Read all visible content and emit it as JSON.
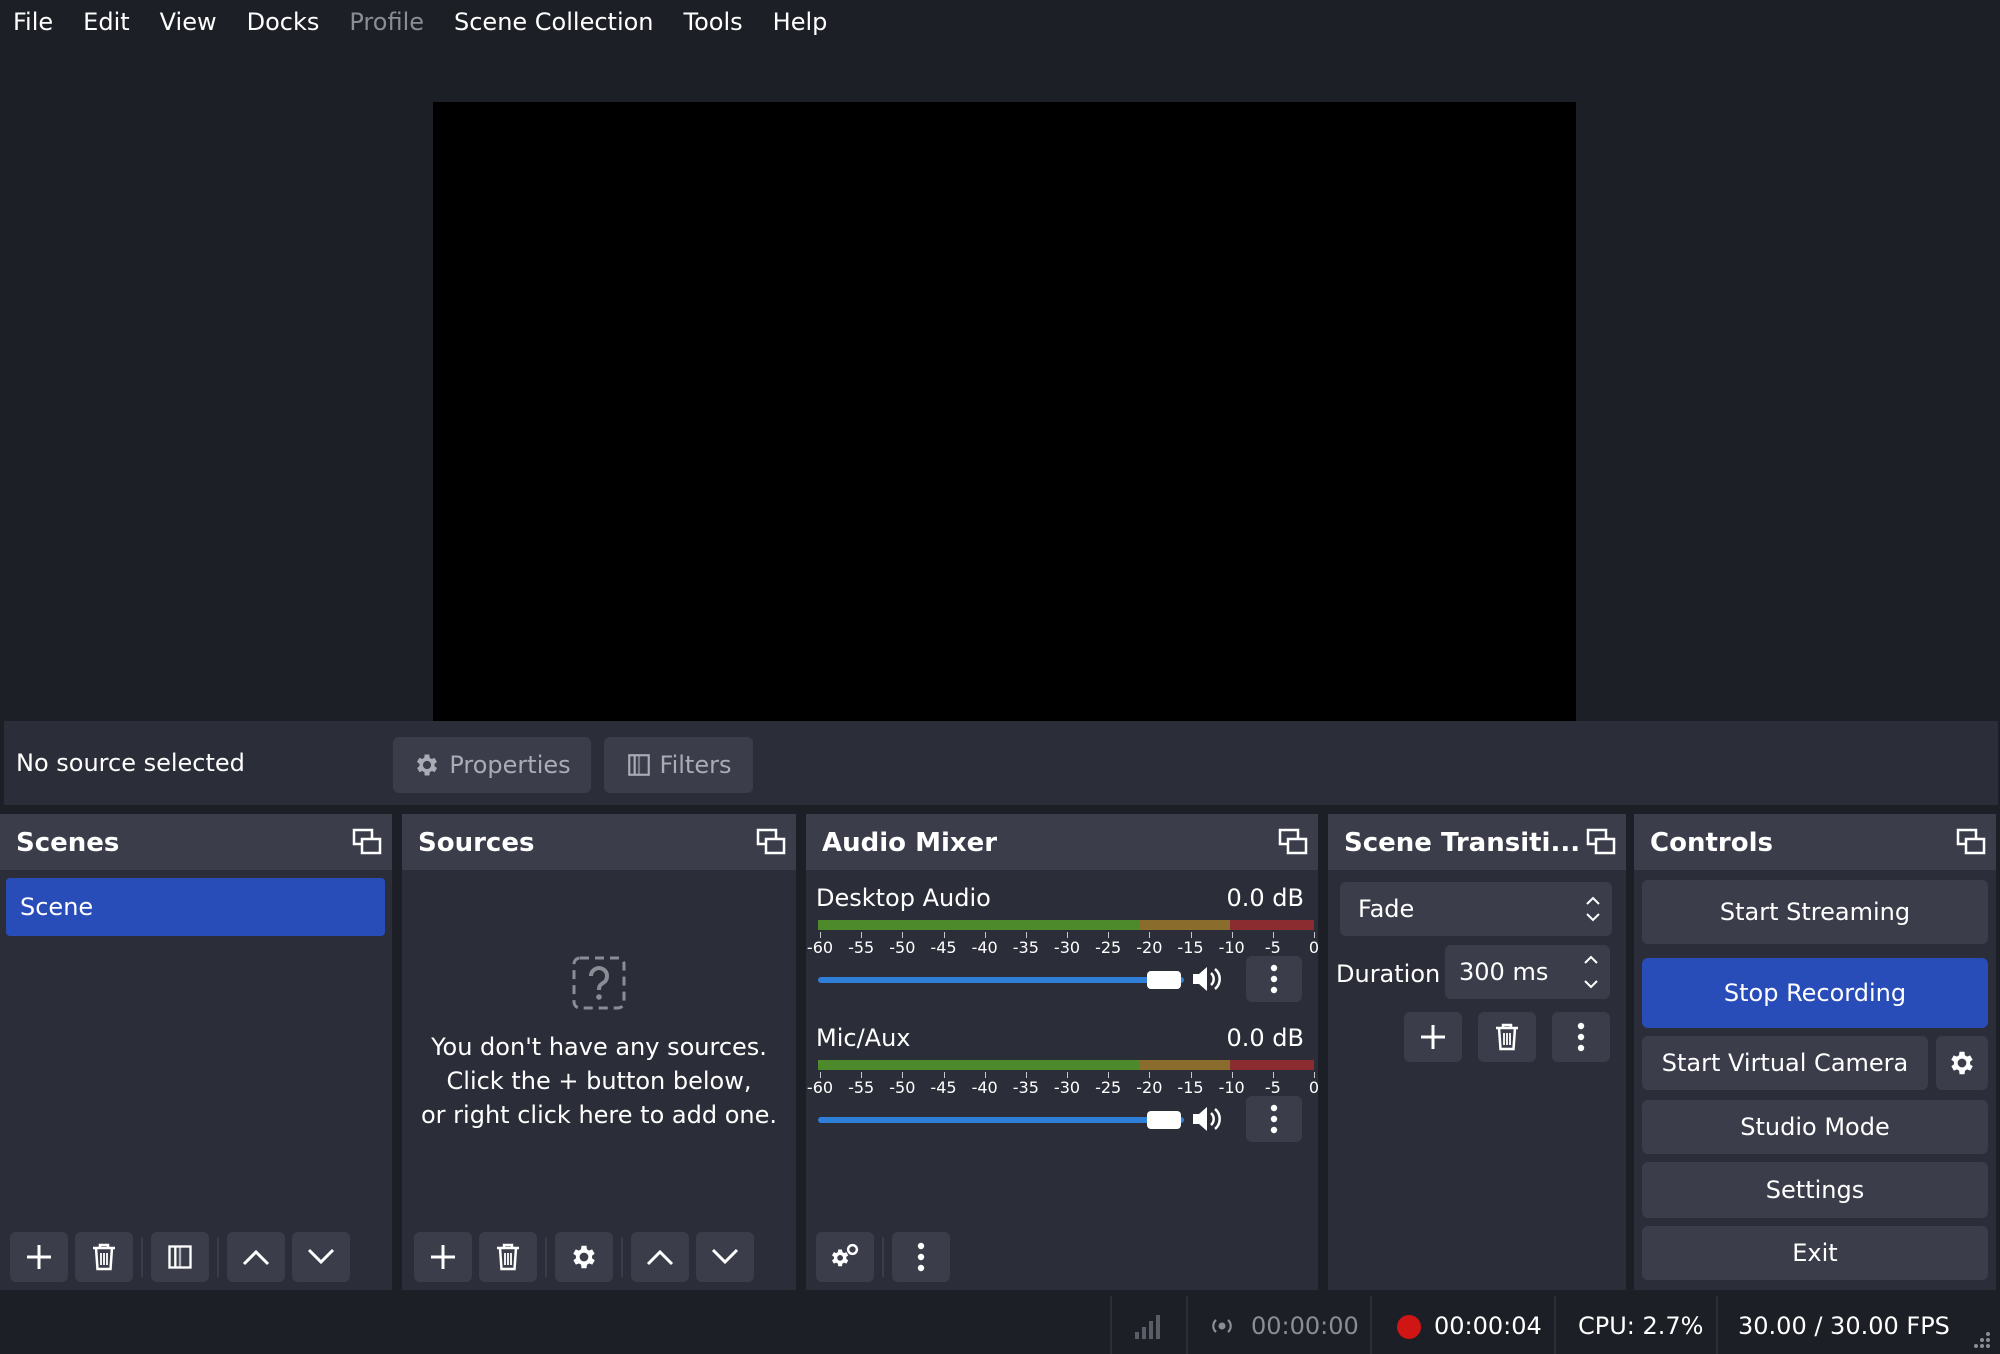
{
  "menu": [
    "File",
    "Edit",
    "View",
    "Docks",
    "Profile",
    "Scene Collection",
    "Tools",
    "Help"
  ],
  "source_toolbar": {
    "status": "No source selected",
    "properties_label": "Properties",
    "filters_label": "Filters"
  },
  "scenes": {
    "title": "Scenes",
    "items": [
      "Scene"
    ]
  },
  "sources": {
    "title": "Sources",
    "empty_line1": "You don't have any sources.",
    "empty_line2": "Click the + button below,",
    "empty_line3": "or right click here to add one."
  },
  "audio_mixer": {
    "title": "Audio Mixer",
    "scale": [
      "-60",
      "-55",
      "-50",
      "-45",
      "-40",
      "-35",
      "-30",
      "-25",
      "-20",
      "-15",
      "-10",
      "-5",
      "0"
    ],
    "channels": [
      {
        "name": "Desktop Audio",
        "db": "0.0 dB",
        "volume": 1.0
      },
      {
        "name": "Mic/Aux",
        "db": "0.0 dB",
        "volume": 1.0
      }
    ]
  },
  "transitions": {
    "title": "Scene Transiti...",
    "selected": "Fade",
    "duration_label": "Duration",
    "duration_value": "300 ms"
  },
  "controls": {
    "title": "Controls",
    "start_streaming": "Start Streaming",
    "stop_recording": "Stop Recording",
    "start_virtual_camera": "Start Virtual Camera",
    "studio_mode": "Studio Mode",
    "settings": "Settings",
    "exit": "Exit"
  },
  "status": {
    "stream_time": "00:00:00",
    "record_time": "00:00:04",
    "cpu": "CPU: 2.7%",
    "fps": "30.00 / 30.00 FPS"
  },
  "colors": {
    "accent": "#284cb8",
    "record": "#d01515",
    "slider": "#2f7ed8"
  }
}
